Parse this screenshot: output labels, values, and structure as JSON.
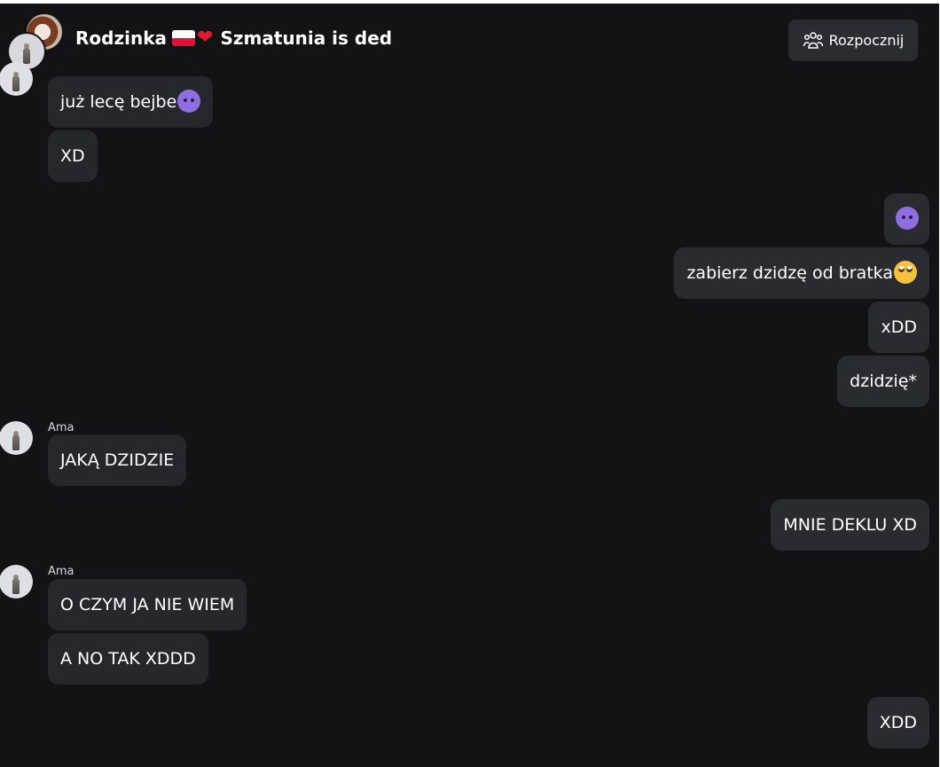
{
  "header": {
    "chat_title": "Rodzinka",
    "chat_title_suffix": "Szmatunia is ded",
    "start_button_label": "Rozpocznij"
  },
  "messages": [
    {
      "sender": "",
      "text": "już lecę bejbe",
      "emoji": "smiling-imp",
      "side": "left"
    },
    {
      "sender": "",
      "text": "XD",
      "side": "left"
    },
    {
      "sender": "",
      "text": "",
      "emoji": "smiling-imp",
      "side": "right"
    },
    {
      "sender": "",
      "text": "zabierz dzidzę od bratka",
      "emoji": "face-with-rolling-eyes",
      "side": "right"
    },
    {
      "sender": "",
      "text": "xDD",
      "side": "right"
    },
    {
      "sender": "",
      "text": "dzidzię*",
      "side": "right"
    },
    {
      "sender": "Ama",
      "text": "JAKĄ DZIDZIE",
      "side": "left"
    },
    {
      "sender": "",
      "text": "MNIE DEKLU XD",
      "side": "right"
    },
    {
      "sender": "Ama",
      "text": "O CZYM JA NIE WIEM",
      "side": "left"
    },
    {
      "sender": "",
      "text": "A NO TAK XDDD",
      "side": "left"
    },
    {
      "sender": "",
      "text": "XDD",
      "side": "right"
    }
  ],
  "colors": {
    "background": "#131316",
    "bubble": "#26272c",
    "text": "#ffffff"
  }
}
